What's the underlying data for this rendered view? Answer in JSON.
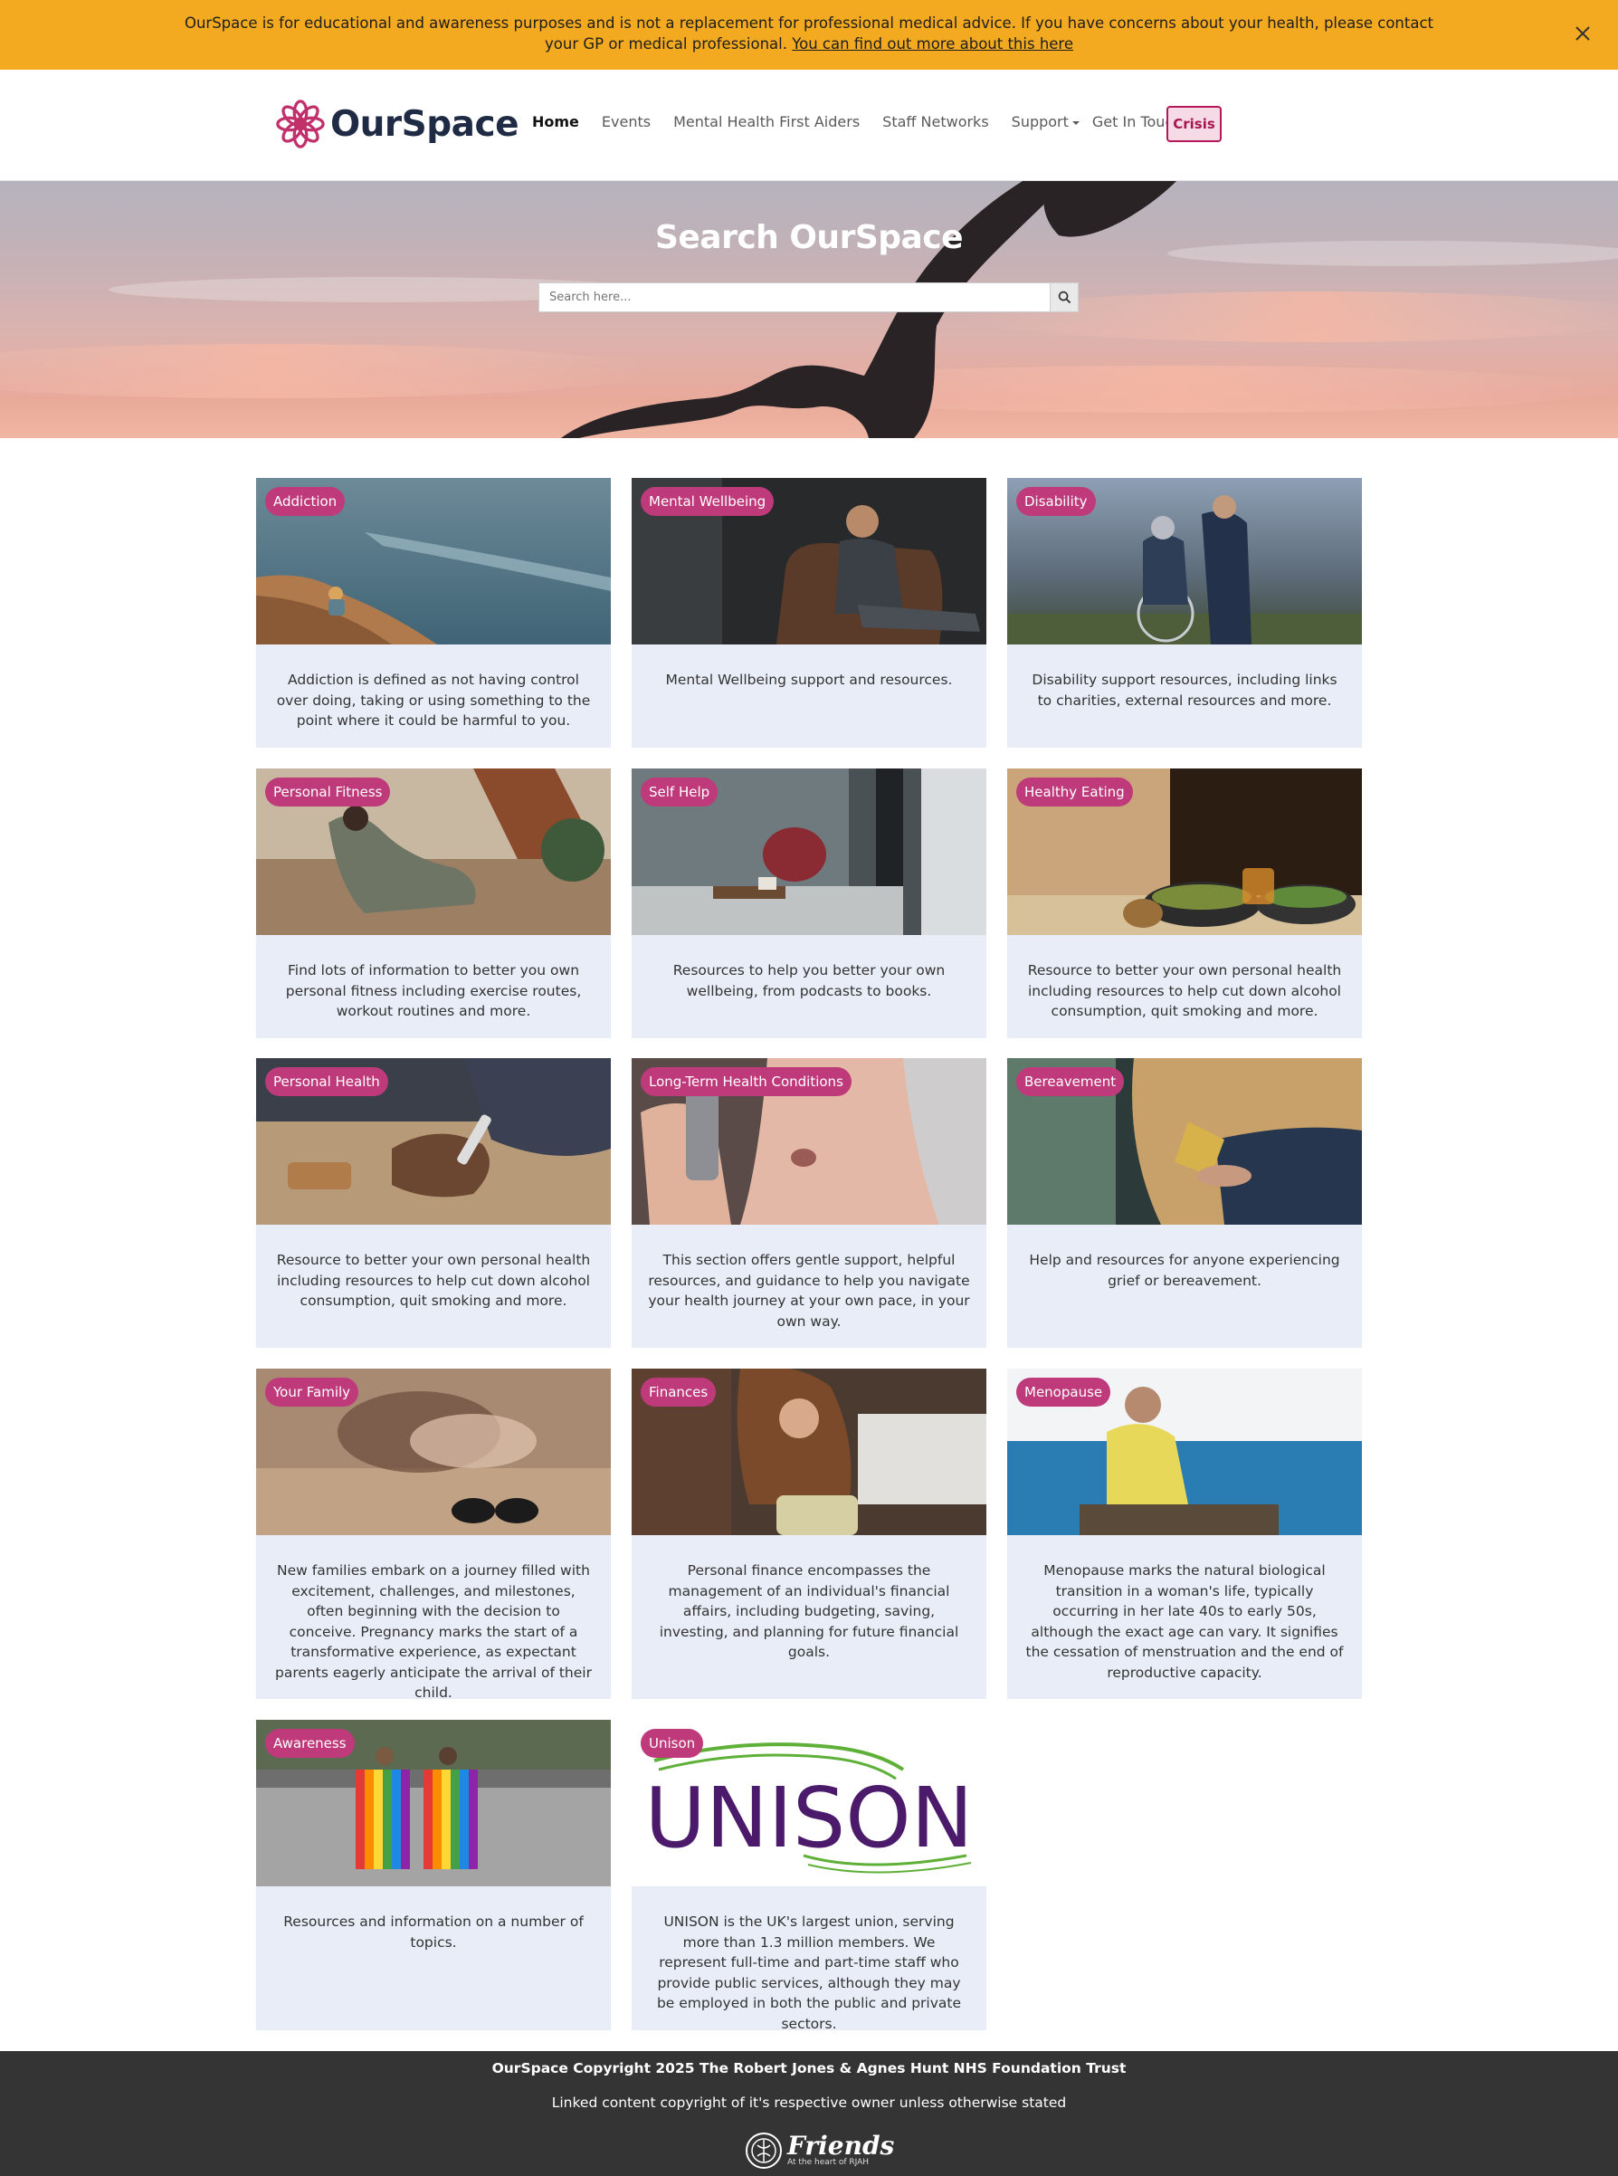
{
  "banner": {
    "text": "OurSpace is for educational and awareness purposes and is not a replacement for professional medical advice. If you have concerns about your health, please contact your GP or medical professional.",
    "link": "You can find out more about this here"
  },
  "header": {
    "logo_text": "OurSpace",
    "nav": [
      "Home",
      "Events",
      "Mental Health First Aiders",
      "Staff Networks",
      "Support",
      "Get In Touch"
    ],
    "crisis_label": "Crisis"
  },
  "hero": {
    "title": "Search OurSpace",
    "search_placeholder": "Search here..."
  },
  "cards": [
    {
      "tag": "Addiction",
      "text": "Addiction is defined as not having control over doing, taking or using something to the point where it could be harmful to you."
    },
    {
      "tag": "Mental Wellbeing",
      "text": "Mental Wellbeing support and resources."
    },
    {
      "tag": "Disability",
      "text": "Disability support resources, including links to charities, external resources and more."
    },
    {
      "tag": "Personal Fitness",
      "text": "Find lots of information to better you own personal fitness including exercise routes, workout routines and more."
    },
    {
      "tag": "Self Help",
      "text": "Resources to help you better your own wellbeing, from podcasts to books."
    },
    {
      "tag": "Healthy Eating",
      "text": "Resource to better your own personal health including resources to help cut down alcohol consumption, quit smoking and more."
    },
    {
      "tag": "Personal Health",
      "text": "Resource to better your own personal health including resources to help cut down alcohol consumption, quit smoking and more."
    },
    {
      "tag": "Long-Term Health Conditions",
      "text": "This section offers gentle support, helpful resources, and guidance to help you navigate your health journey at your own pace, in your own way."
    },
    {
      "tag": "Bereavement",
      "text": "Help and resources for anyone experiencing grief or bereavement."
    },
    {
      "tag": "Your Family",
      "text": "New families embark on a journey filled with excitement, challenges, and milestones, often beginning with the decision to conceive. Pregnancy marks the start of a transformative experience, as expectant parents eagerly anticipate the arrival of their child."
    },
    {
      "tag": "Finances",
      "text": "Personal finance encompasses the management of an individual's financial affairs, including budgeting, saving, investing, and planning for future financial goals."
    },
    {
      "tag": "Menopause",
      "text": "Menopause marks the natural biological transition in a woman's life, typically occurring in her late 40s to early 50s, although the exact age can vary. It signifies the cessation of menstruation and the end of reproductive capacity."
    },
    {
      "tag": "Awareness",
      "text": "Resources and information on a number of topics."
    },
    {
      "tag": "Unison",
      "text": "UNISON is the UK's largest union, serving more than 1.3 million members. We represent full-time and part-time staff who provide public services, although they may be employed in both the public and private sectors.",
      "logo_text": "UNISON"
    }
  ],
  "footer": {
    "copyright": "OurSpace Copyright 2025 The Robert Jones & Agnes Hunt NHS Foundation Trust",
    "linked": "Linked content copyright of it's respective owner unless otherwise stated",
    "friends_logo": "Friends",
    "friends_sub": "At the heart of RJAH"
  },
  "colors": {
    "banner": "#f3a920",
    "tag": "#be3a7b",
    "card_bg": "#e8edf7",
    "footer": "#343434",
    "crisis": "#b5175d"
  }
}
